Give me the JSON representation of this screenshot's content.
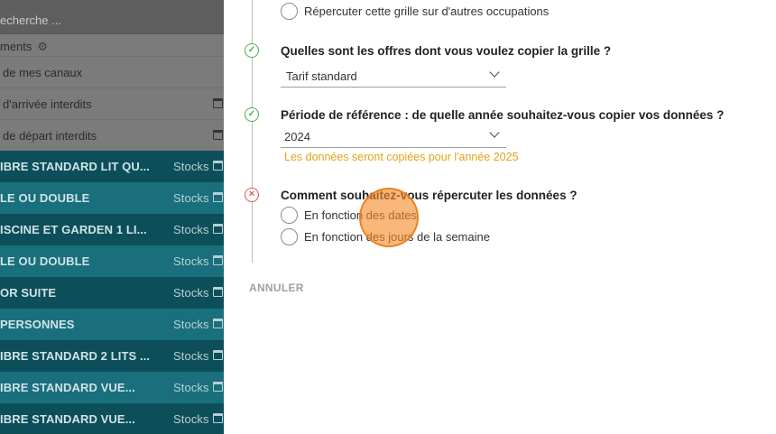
{
  "sidebar": {
    "search_placeholder": "echerche ...",
    "settings_label": "ments",
    "options": [
      {
        "label": "de mes canaux"
      },
      {
        "label": "d'arrivée interdits"
      },
      {
        "label": "de départ interdits"
      }
    ],
    "rooms": [
      {
        "label": "IBRE STANDARD LIT QU...",
        "stocks": "Stocks"
      },
      {
        "label": "LE OU DOUBLE",
        "stocks": "Stocks"
      },
      {
        "label": "ISCINE ET GARDEN 1 LI...",
        "stocks": "Stocks"
      },
      {
        "label": "LE OU DOUBLE",
        "stocks": "Stocks"
      },
      {
        "label": "OR SUITE",
        "stocks": "Stocks"
      },
      {
        "label": "PERSONNES",
        "stocks": "Stocks"
      },
      {
        "label": "IBRE STANDARD 2 LITS ...",
        "stocks": "Stocks"
      },
      {
        "label": "IBRE STANDARD VUE...",
        "stocks": "Stocks"
      },
      {
        "label": "IBRE STANDARD VUE...",
        "stocks": "Stocks"
      }
    ]
  },
  "dialog": {
    "top_radio_label": "Répercuter cette grille sur d'autres occupations",
    "q1": {
      "question": "Quelles sont les offres dont vous voulez copier la grille ?",
      "selected": "Tarif standard",
      "status": "ok"
    },
    "q2": {
      "question": "Période de référence : de quelle année souhaitez-vous copier vos données ?",
      "selected": "2024",
      "hint": "Les données seront copiées pour l'année 2025",
      "status": "ok"
    },
    "q3": {
      "question": "Comment souhaitez-vous répercuter les données ?",
      "options": [
        "En fonction des dates",
        "En fonction des jours de la semaine"
      ],
      "status": "error"
    },
    "cancel_label": "ANNULER"
  },
  "colors": {
    "success": "#4caf50",
    "error": "#e05252",
    "warning_text": "#e3a21a",
    "room_dark": "#0d4e5b",
    "room_light": "#1a6f7c",
    "click_highlight": "#f58c28"
  },
  "icons": {
    "settings": "gear-icon",
    "calendar": "calendar-icon",
    "step_ok": "check-circle-icon",
    "step_error": "close-circle-icon",
    "dropdown": "chevron-down-icon"
  }
}
